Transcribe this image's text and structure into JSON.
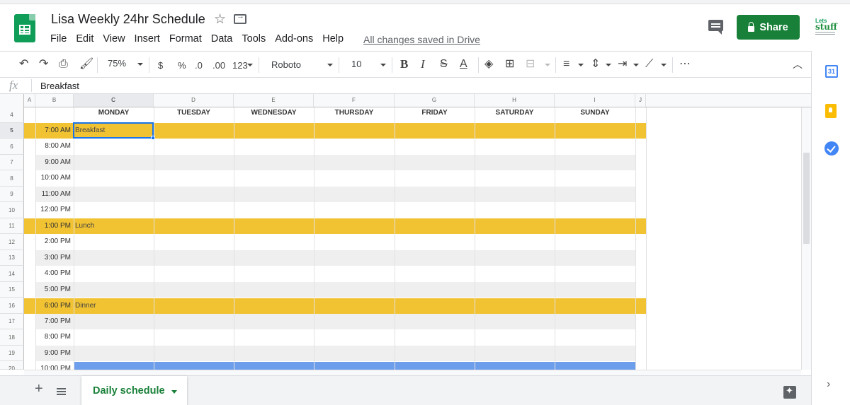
{
  "app": {
    "title": "Lisa Weekly 24hr Schedule",
    "save_status": "All changes saved in Drive",
    "menus": [
      "File",
      "Edit",
      "View",
      "Insert",
      "Format",
      "Data",
      "Tools",
      "Add-ons",
      "Help"
    ],
    "share_label": "Share",
    "brand_text_top": "Lets",
    "brand_text_main": "stuff"
  },
  "toolbar": {
    "zoom": "75%",
    "currency": "$",
    "percent": "%",
    "decrease_decimals": ".0",
    "increase_decimals": ".00",
    "number_format": "123",
    "font": "Roboto",
    "font_size": "10",
    "bold": "B",
    "italic": "I",
    "strike": "S",
    "text_color": "A",
    "more": "⋯"
  },
  "formula_bar": {
    "fx": "fx",
    "value": "Breakfast"
  },
  "grid": {
    "columns": [
      "A",
      "B",
      "C",
      "D",
      "E",
      "F",
      "G",
      "H",
      "I",
      "J"
    ],
    "selected_column": "C",
    "day_headers": [
      "MONDAY",
      "TUESDAY",
      "WEDNESDAY",
      "THURSDAY",
      "FRIDAY",
      "SATURDAY",
      "SUNDAY"
    ],
    "rows": [
      {
        "num": "4",
        "time": "",
        "event": ""
      },
      {
        "num": "5",
        "time": "7:00 AM",
        "event": "Breakfast"
      },
      {
        "num": "6",
        "time": "8:00 AM",
        "event": ""
      },
      {
        "num": "7",
        "time": "9:00 AM",
        "event": ""
      },
      {
        "num": "8",
        "time": "10:00 AM",
        "event": ""
      },
      {
        "num": "9",
        "time": "11:00 AM",
        "event": ""
      },
      {
        "num": "10",
        "time": "12:00 PM",
        "event": ""
      },
      {
        "num": "11",
        "time": "1:00 PM",
        "event": "Lunch"
      },
      {
        "num": "12",
        "time": "2:00 PM",
        "event": ""
      },
      {
        "num": "13",
        "time": "3:00 PM",
        "event": ""
      },
      {
        "num": "14",
        "time": "4:00 PM",
        "event": ""
      },
      {
        "num": "15",
        "time": "5:00 PM",
        "event": ""
      },
      {
        "num": "16",
        "time": "6:00 PM",
        "event": "Dinner"
      },
      {
        "num": "17",
        "time": "7:00 PM",
        "event": ""
      },
      {
        "num": "18",
        "time": "8:00 PM",
        "event": ""
      },
      {
        "num": "19",
        "time": "9:00 PM",
        "event": ""
      },
      {
        "num": "20",
        "time": "10:00 PM",
        "event": ""
      }
    ],
    "selected_row": "5",
    "colors": {
      "meal_band": "#f1c232",
      "stripe": "#efefef",
      "blue_band": "#6d9eeb",
      "selection": "#1a73e8"
    }
  },
  "sheet_tabs": {
    "active": "Daily schedule"
  },
  "side_panel": {
    "calendar_day": "31"
  },
  "icons": [
    "undo-icon",
    "redo-icon",
    "print-icon",
    "paint-format-icon",
    "fill-color-icon",
    "borders-icon",
    "merge-icon",
    "align-icon",
    "valign-icon",
    "wrap-icon",
    "rotate-icon",
    "comment-icon",
    "star-icon",
    "move-icon",
    "lock-icon",
    "add-sheet-icon",
    "all-sheets-icon",
    "explore-icon",
    "calendar-icon",
    "keep-icon",
    "tasks-icon"
  ]
}
